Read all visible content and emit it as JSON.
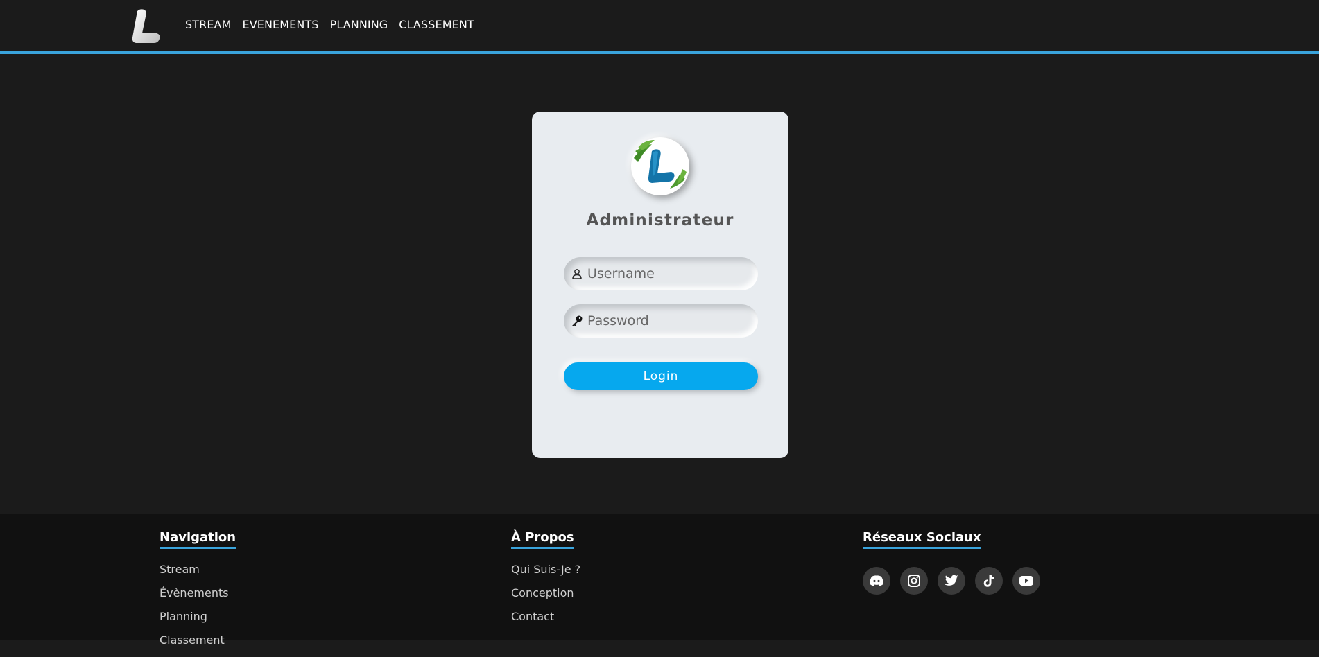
{
  "header": {
    "logo_alt": "L",
    "nav": [
      {
        "label": "STREAM"
      },
      {
        "label": "EVENEMENTS"
      },
      {
        "label": "PLANNING"
      },
      {
        "label": "CLASSEMENT"
      }
    ],
    "accent_color": "#3aa4dc"
  },
  "login": {
    "title": "Administrateur",
    "username_placeholder": "Username",
    "password_placeholder": "Password",
    "button_label": "Login",
    "button_color": "#06a8ee",
    "username_icon": "user-icon",
    "password_icon": "key-icon"
  },
  "footer": {
    "navigation": {
      "title": "Navigation",
      "items": [
        "Stream",
        "Évènements",
        "Planning",
        "Classement"
      ]
    },
    "about": {
      "title": "À Propos",
      "items": [
        "Qui Suis-Je ?",
        "Conception",
        "Contact"
      ]
    },
    "social": {
      "title": "Réseaux Sociaux",
      "icons": [
        "discord-icon",
        "instagram-icon",
        "twitter-icon",
        "tiktok-icon",
        "youtube-icon"
      ]
    }
  }
}
